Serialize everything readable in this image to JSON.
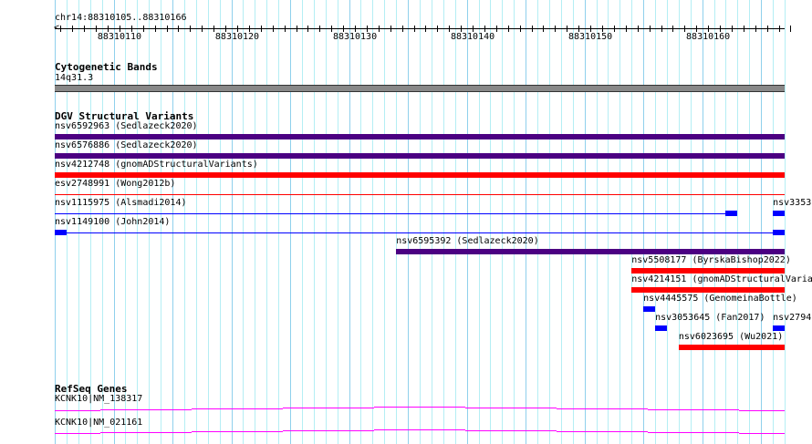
{
  "ruler": {
    "location": "chr14:88310105..88310166",
    "start": 88310105,
    "end": 88310167,
    "tick_labels": [
      "88310110",
      "88310120",
      "88310130",
      "88310140",
      "88310150",
      "88310160"
    ]
  },
  "cyto": {
    "title": "Cytogenetic Bands",
    "band": "14q31.3",
    "color": "#888888"
  },
  "dgv": {
    "title": "DGV Structural Variants",
    "features": [
      {
        "label": "nsv6592963 (Sedlazeck2020)",
        "row": 0,
        "start": 88310105,
        "end": 88310167,
        "style": "thick",
        "color": "#4b0082"
      },
      {
        "label": "nsv6576886 (Sedlazeck2020)",
        "row": 1,
        "start": 88310105,
        "end": 88310167,
        "style": "thick",
        "color": "#4b0082"
      },
      {
        "label": "nsv4212748 (gnomADStructuralVariants)",
        "row": 2,
        "start": 88310105,
        "end": 88310167,
        "style": "thick",
        "color": "#ff0000"
      },
      {
        "label": "esv2748991 (Wong2012b)",
        "row": 3,
        "start": 88310105,
        "end": 88310167,
        "style": "thin",
        "color": "#ff0000"
      },
      {
        "label": "nsv1115975 (Alsmadi2014)",
        "row": 4,
        "start": 88310105,
        "end": 88310163,
        "style": "thin",
        "color": "#0000ff",
        "boxes": [
          [
            88310162,
            88310163
          ]
        ]
      },
      {
        "label": "nsv3353",
        "row": 4,
        "start": 88310166,
        "end": 88310167,
        "style": "box",
        "color": "#0000ff"
      },
      {
        "label": "nsv1149100 (John2014)",
        "row": 5,
        "start": 88310105,
        "end": 88310167,
        "style": "thin",
        "color": "#0000ff",
        "boxes": [
          [
            88310105,
            88310106
          ],
          [
            88310166,
            88310167
          ]
        ]
      },
      {
        "label": "nsv6595392 (Sedlazeck2020)",
        "row": 6,
        "start": 88310134,
        "end": 88310167,
        "style": "thick",
        "color": "#4b0082"
      },
      {
        "label": "nsv5508177 (ByrskaBishop2022)",
        "row": 7,
        "start": 88310154,
        "end": 88310167,
        "style": "thick",
        "color": "#ff0000"
      },
      {
        "label": "nsv4214151 (gnomADStructuralVaria",
        "row": 8,
        "start": 88310154,
        "end": 88310167,
        "style": "thick",
        "color": "#ff0000"
      },
      {
        "label": "nsv4445575 (GenomeinaBottle)",
        "row": 9,
        "start": 88310155,
        "end": 88310156,
        "style": "box",
        "color": "#0000ff"
      },
      {
        "label": "nsv3053645 (Fan2017)",
        "row": 10,
        "start": 88310156,
        "end": 88310157,
        "style": "box",
        "color": "#0000ff"
      },
      {
        "label": "nsv2794",
        "row": 10,
        "start": 88310166,
        "end": 88310167,
        "style": "box",
        "color": "#0000ff"
      },
      {
        "label": "nsv6023695 (Wu2021)",
        "row": 11,
        "start": 88310158,
        "end": 88310167,
        "style": "thick",
        "color": "#ff0000"
      }
    ]
  },
  "genes": {
    "title": "RefSeq Genes",
    "color": "#ff00ff",
    "transcripts": [
      {
        "label": "KCNK10|NM_138317"
      },
      {
        "label": "KCNK10|NM_021161"
      }
    ]
  }
}
